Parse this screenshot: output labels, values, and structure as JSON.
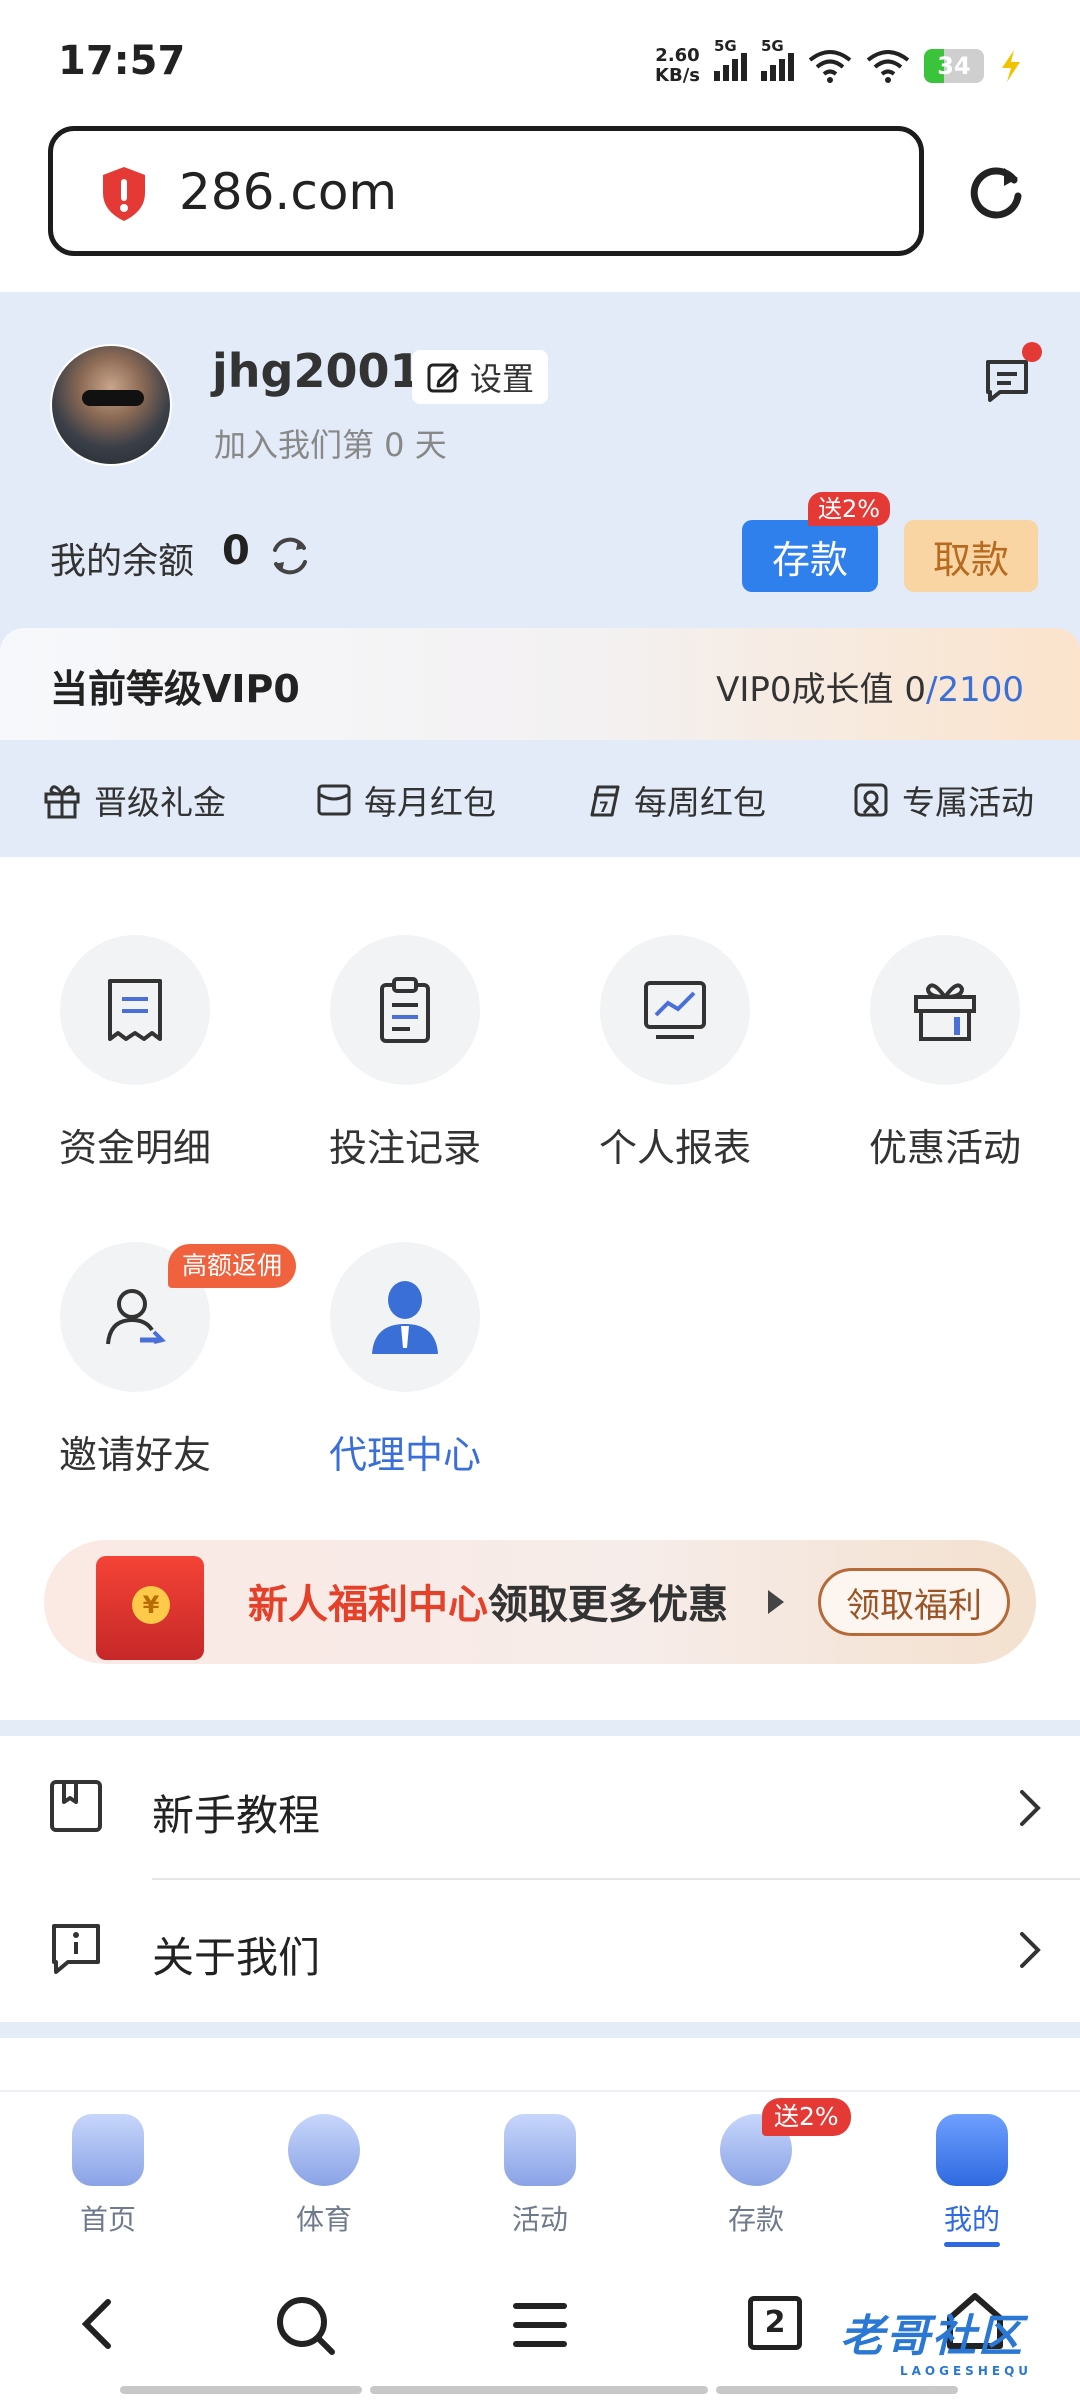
{
  "status": {
    "time": "17:57",
    "speed_top": "2.60",
    "speed_unit": "KB/s",
    "net1": "5G",
    "net2": "5G",
    "battery": "34",
    "battery_level": 0.34
  },
  "browser": {
    "url": "286.com"
  },
  "profile": {
    "username": "jhg2001",
    "settings_label": "设置",
    "joined": "加入我们第 0 天",
    "balance_label": "我的余额",
    "balance_value": "0",
    "deposit_label": "存款",
    "deposit_badge": "送2%",
    "withdraw_label": "取款"
  },
  "vip": {
    "title": "当前等级VIP0",
    "growth_label": "VIP0成长值",
    "growth_current": "0",
    "growth_target": "/2100",
    "perks": [
      "晋级礼金",
      "每月红包",
      "每周红包",
      "专属活动"
    ]
  },
  "grid": [
    {
      "label": "资金明细",
      "icon": "receipt-icon"
    },
    {
      "label": "投注记录",
      "icon": "clipboard-icon"
    },
    {
      "label": "个人报表",
      "icon": "chart-monitor-icon"
    },
    {
      "label": "优惠活动",
      "icon": "gift-box-icon"
    },
    {
      "label": "邀请好友",
      "icon": "invite-user-icon",
      "badge": "高额返佣"
    },
    {
      "label": "代理中心",
      "icon": "agent-icon"
    }
  ],
  "banner": {
    "highlight": "新人福利中心",
    "text": "领取更多优惠",
    "button": "领取福利",
    "coin": "¥"
  },
  "list": [
    {
      "label": "新手教程",
      "icon": "book-icon"
    },
    {
      "label": "关于我们",
      "icon": "info-icon"
    }
  ],
  "tabs": [
    {
      "label": "首页",
      "icon": "home-icon"
    },
    {
      "label": "体育",
      "icon": "sports-icon"
    },
    {
      "label": "活动",
      "icon": "activity-icon"
    },
    {
      "label": "存款",
      "icon": "deposit-icon",
      "badge": "送2%"
    },
    {
      "label": "我的",
      "icon": "profile-icon",
      "active": true
    }
  ],
  "browser_nav": {
    "tab_count": "2"
  },
  "watermark": {
    "text": "老哥社区",
    "sub": "LAOGESHEQU"
  },
  "colors": {
    "accent": "#2f80ed",
    "brand_blue": "#3a6fd8",
    "danger": "#e53935",
    "withdraw": "#f8d5a3",
    "header_bg": "#e2ebf7"
  }
}
